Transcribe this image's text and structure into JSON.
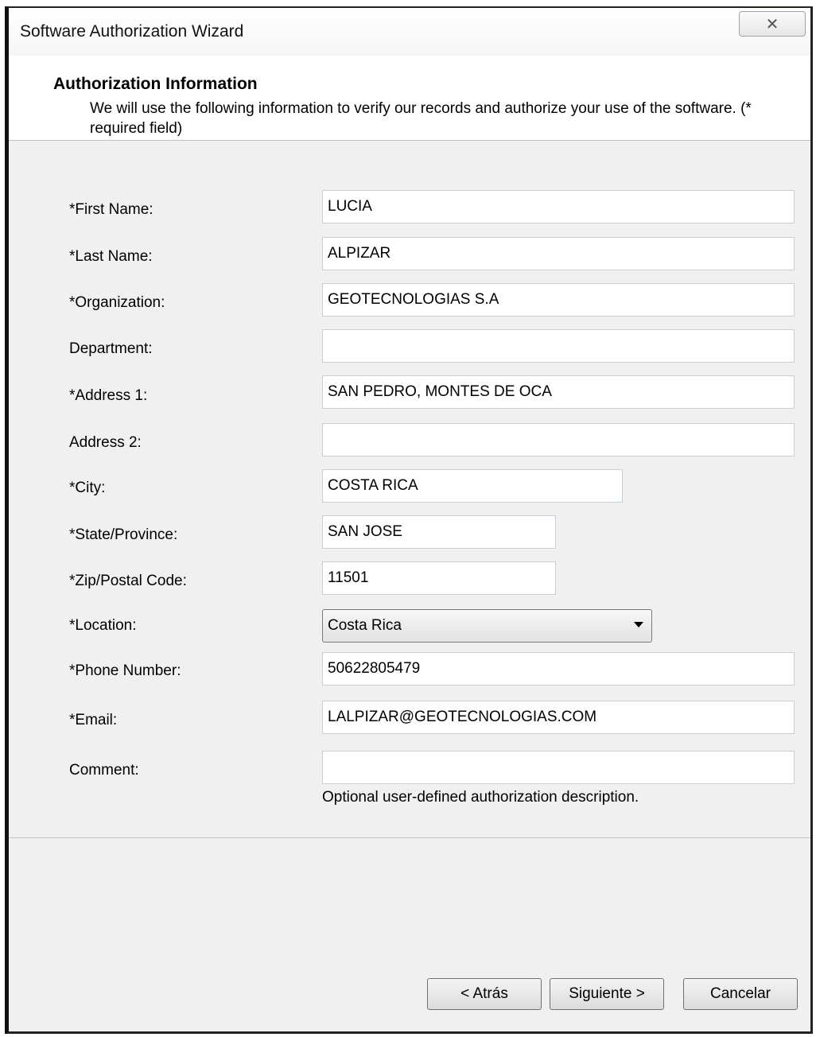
{
  "window": {
    "title": "Software Authorization Wizard",
    "close_glyph": "☒"
  },
  "header": {
    "title": "Authorization Information",
    "description": "We will use the following information to verify our records and authorize your use of the software. (* required field)"
  },
  "form": {
    "first_name": {
      "label": "*First Name:",
      "value": "LUCIA"
    },
    "last_name": {
      "label": "*Last Name:",
      "value": "ALPIZAR"
    },
    "organization": {
      "label": "*Organization:",
      "value": "GEOTECNOLOGIAS S.A"
    },
    "department": {
      "label": "Department:",
      "value": ""
    },
    "address1": {
      "label": "*Address 1:",
      "value": "SAN PEDRO, MONTES DE OCA"
    },
    "address2": {
      "label": "Address 2:",
      "value": ""
    },
    "city": {
      "label": "*City:",
      "value": "COSTA RICA"
    },
    "state": {
      "label": "*State/Province:",
      "value": "SAN JOSE"
    },
    "zip": {
      "label": "*Zip/Postal Code:",
      "value": "11501"
    },
    "location": {
      "label": "*Location:",
      "value": "Costa Rica"
    },
    "phone": {
      "label": "*Phone Number:",
      "value": "50622805479"
    },
    "email": {
      "label": "*Email:",
      "value": "LALPIZAR@GEOTECNOLOGIAS.COM"
    },
    "comment": {
      "label": "Comment:",
      "value": "",
      "hint": "Optional user-defined authorization description."
    }
  },
  "footer": {
    "back": "< Atrás",
    "next": "Siguiente >",
    "cancel": "Cancelar"
  }
}
